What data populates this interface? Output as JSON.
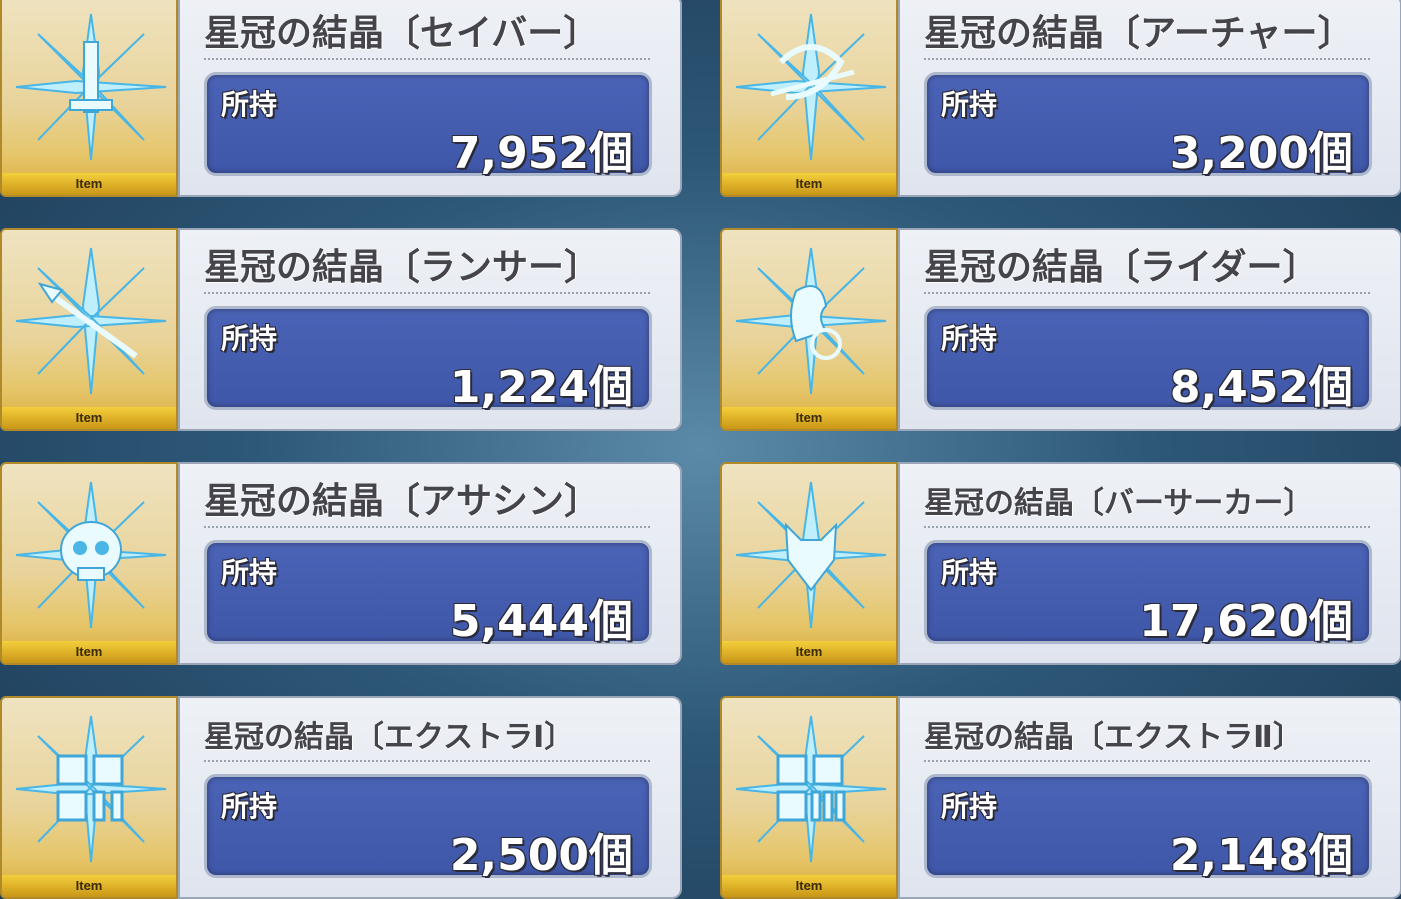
{
  "items": [
    {
      "name": "星冠の結晶〔セイバー〕",
      "owned_label": "所持",
      "count": "7,952個",
      "tag": "Item",
      "icon": "sword-crystal-icon"
    },
    {
      "name": "星冠の結晶〔アーチャー〕",
      "owned_label": "所持",
      "count": "3,200個",
      "tag": "Item",
      "icon": "bow-crystal-icon"
    },
    {
      "name": "星冠の結晶〔ランサー〕",
      "owned_label": "所持",
      "count": "1,224個",
      "tag": "Item",
      "icon": "spear-crystal-icon"
    },
    {
      "name": "星冠の結晶〔ライダー〕",
      "owned_label": "所持",
      "count": "8,452個",
      "tag": "Item",
      "icon": "horse-crystal-icon"
    },
    {
      "name": "星冠の結晶〔アサシン〕",
      "owned_label": "所持",
      "count": "5,444個",
      "tag": "Item",
      "icon": "skull-crystal-icon"
    },
    {
      "name": "星冠の結晶〔バーサーカー〕",
      "owned_label": "所持",
      "count": "17,620個",
      "tag": "Item",
      "icon": "beast-crystal-icon"
    },
    {
      "name": "星冠の結晶〔エクストラⅠ〕",
      "owned_label": "所持",
      "count": "2,500個",
      "tag": "Item",
      "icon": "extra-one-crystal-icon"
    },
    {
      "name": "星冠の結晶〔エクストラⅡ〕",
      "owned_label": "所持",
      "count": "2,148個",
      "tag": "Item",
      "icon": "extra-two-crystal-icon"
    }
  ],
  "colors": {
    "count_box": "#4259aa",
    "item_tag": "#e2b42a",
    "crystal": "#7fd3f2"
  }
}
